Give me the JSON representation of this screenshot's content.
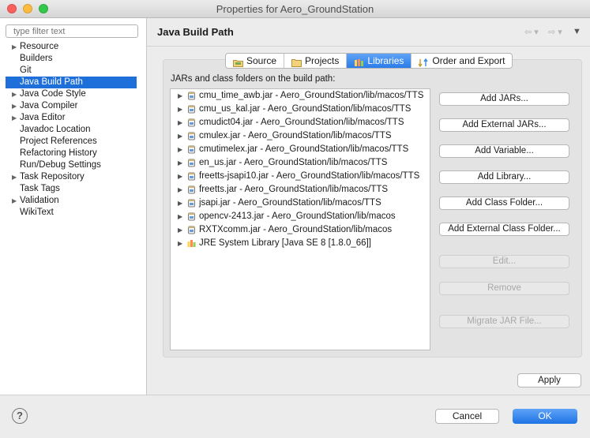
{
  "window": {
    "title": "Properties for Aero_GroundStation"
  },
  "sidebar": {
    "filter_placeholder": "type filter text",
    "items": [
      {
        "label": "Resource",
        "expandable": true
      },
      {
        "label": "Builders",
        "expandable": false
      },
      {
        "label": "Git",
        "expandable": false
      },
      {
        "label": "Java Build Path",
        "expandable": false,
        "selected": true
      },
      {
        "label": "Java Code Style",
        "expandable": true
      },
      {
        "label": "Java Compiler",
        "expandable": true
      },
      {
        "label": "Java Editor",
        "expandable": true
      },
      {
        "label": "Javadoc Location",
        "expandable": false
      },
      {
        "label": "Project References",
        "expandable": false
      },
      {
        "label": "Refactoring History",
        "expandable": false
      },
      {
        "label": "Run/Debug Settings",
        "expandable": false
      },
      {
        "label": "Task Repository",
        "expandable": true
      },
      {
        "label": "Task Tags",
        "expandable": false
      },
      {
        "label": "Validation",
        "expandable": true
      },
      {
        "label": "WikiText",
        "expandable": false
      }
    ]
  },
  "header": {
    "title": "Java Build Path"
  },
  "tabs": [
    {
      "label": "Source",
      "icon": "source-folder-icon",
      "active": false
    },
    {
      "label": "Projects",
      "icon": "projects-folder-icon",
      "active": false
    },
    {
      "label": "Libraries",
      "icon": "libraries-icon",
      "active": true
    },
    {
      "label": "Order and Export",
      "icon": "order-export-icon",
      "active": false
    }
  ],
  "libraries": {
    "label": "JARs and class folders on the build path:",
    "entries": [
      {
        "text": "cmu_time_awb.jar - Aero_GroundStation/lib/macos/TTS",
        "icon": "jar-icon"
      },
      {
        "text": "cmu_us_kal.jar - Aero_GroundStation/lib/macos/TTS",
        "icon": "jar-icon"
      },
      {
        "text": "cmudict04.jar - Aero_GroundStation/lib/macos/TTS",
        "icon": "jar-icon"
      },
      {
        "text": "cmulex.jar - Aero_GroundStation/lib/macos/TTS",
        "icon": "jar-icon"
      },
      {
        "text": "cmutimelex.jar - Aero_GroundStation/lib/macos/TTS",
        "icon": "jar-icon"
      },
      {
        "text": "en_us.jar - Aero_GroundStation/lib/macos/TTS",
        "icon": "jar-icon"
      },
      {
        "text": "freetts-jsapi10.jar - Aero_GroundStation/lib/macos/TTS",
        "icon": "jar-icon"
      },
      {
        "text": "freetts.jar - Aero_GroundStation/lib/macos/TTS",
        "icon": "jar-icon"
      },
      {
        "text": "jsapi.jar - Aero_GroundStation/lib/macos/TTS",
        "icon": "jar-icon"
      },
      {
        "text": "opencv-2413.jar - Aero_GroundStation/lib/macos",
        "icon": "jar-icon"
      },
      {
        "text": "RXTXcomm.jar - Aero_GroundStation/lib/macos",
        "icon": "jar-icon"
      },
      {
        "text": "JRE System Library [Java SE 8 [1.8.0_66]]",
        "icon": "library-icon"
      }
    ]
  },
  "buttons": {
    "add_jars": "Add JARs...",
    "add_external_jars": "Add External JARs...",
    "add_variable": "Add Variable...",
    "add_library": "Add Library...",
    "add_class_folder": "Add Class Folder...",
    "add_external_class_folder": "Add External Class Folder...",
    "edit": "Edit...",
    "remove": "Remove",
    "migrate_jar": "Migrate JAR File..."
  },
  "footer": {
    "apply": "Apply",
    "cancel": "Cancel",
    "ok": "OK",
    "help_glyph": "?"
  },
  "colors": {
    "accent": "#2a7ce8",
    "selection": "#1e6fd9"
  }
}
